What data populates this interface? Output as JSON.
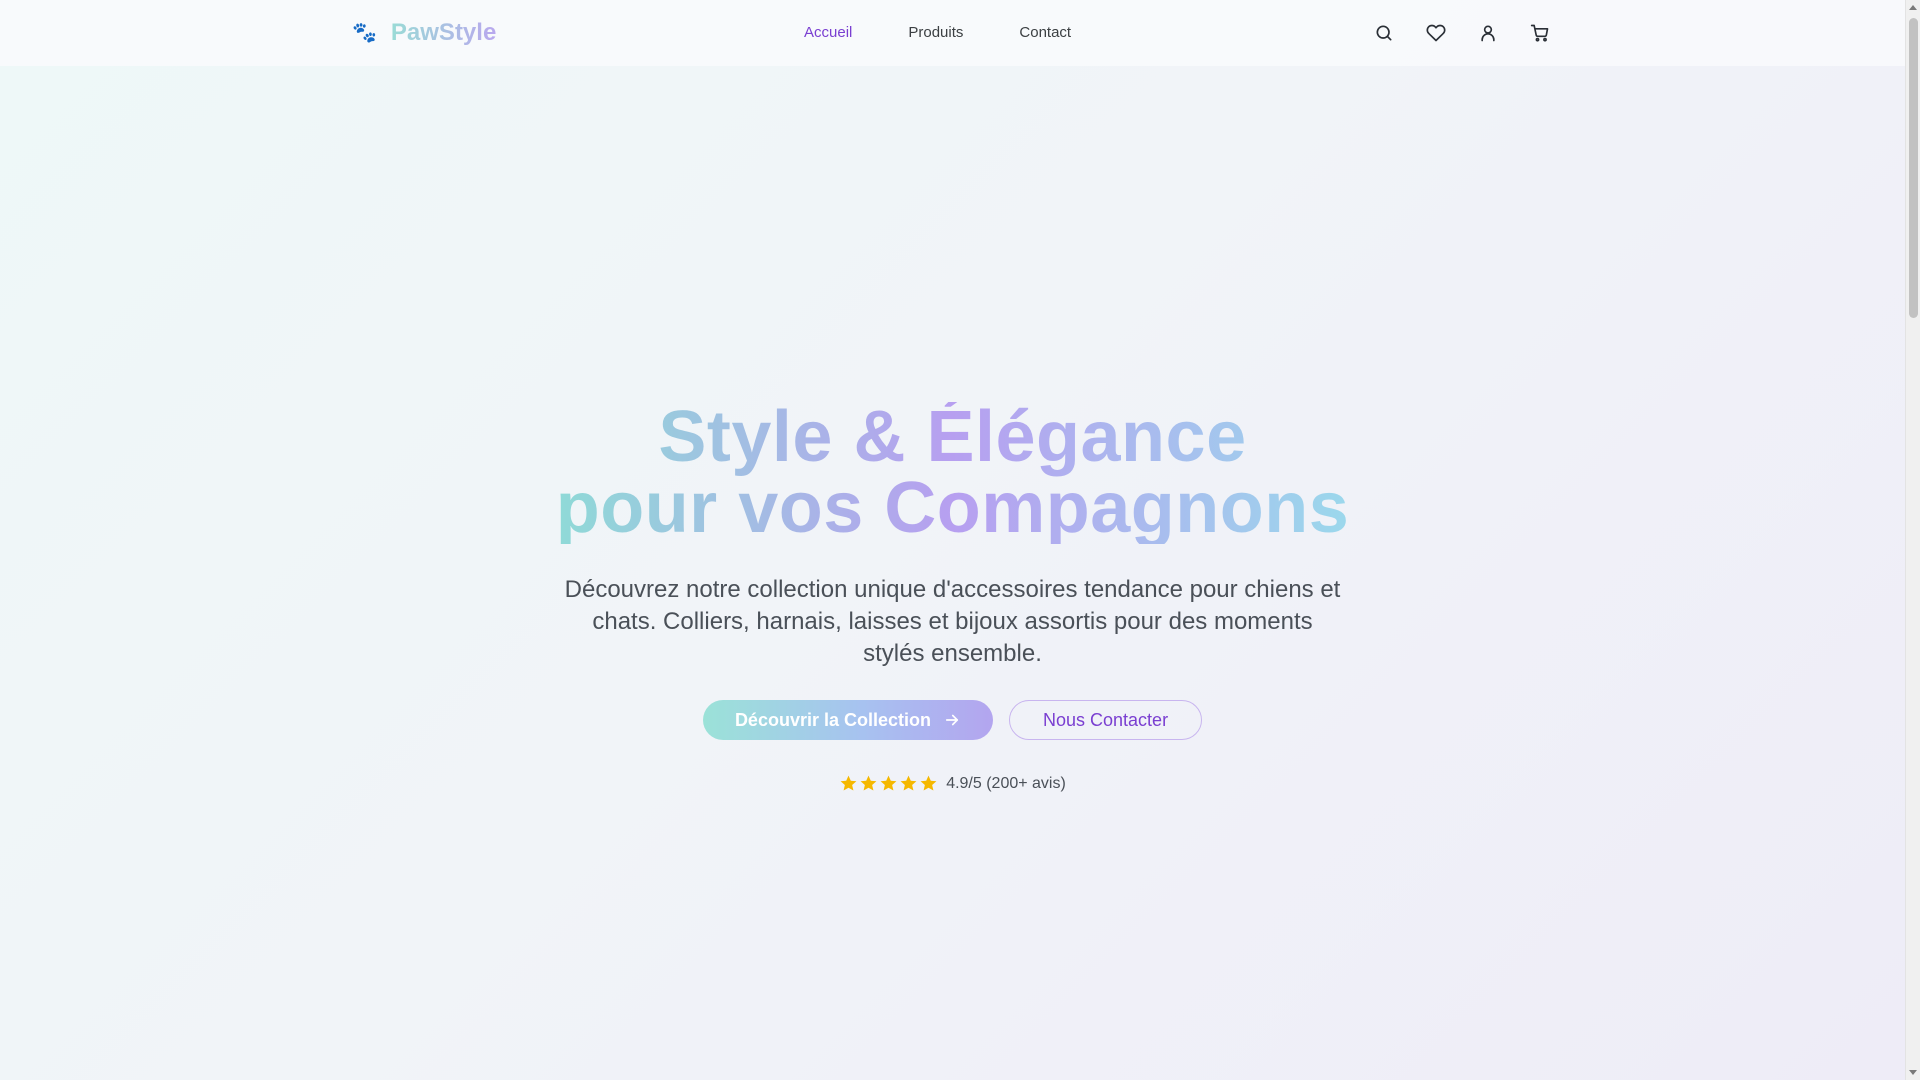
{
  "brand": {
    "name": "PawStyle",
    "icon": "paw-icon",
    "icon_glyph": "🐾"
  },
  "nav": {
    "items": [
      {
        "label": "Accueil",
        "active": true
      },
      {
        "label": "Produits",
        "active": false
      },
      {
        "label": "Contact",
        "active": false
      }
    ]
  },
  "actions": {
    "icons": [
      "search-icon",
      "heart-icon",
      "user-icon",
      "cart-icon"
    ]
  },
  "hero": {
    "title_line1": "Style & Élégance",
    "title_line2": "pour vos Compagnons",
    "description": "Découvrez notre collection unique d'accessoires tendance pour chiens et chats. Colliers, harnais, laisses et bijoux assortis pour des moments stylés ensemble.",
    "primary_cta": "Découvrir la Collection",
    "secondary_cta": "Nous Contacter",
    "rating": {
      "stars": 5,
      "text": "4.9/5 (200+ avis)"
    }
  },
  "colors": {
    "accent": "#7a3fd1",
    "star": "#f5b800",
    "gradient_start": "#9be2d8",
    "gradient_end": "#b3a5ef"
  }
}
